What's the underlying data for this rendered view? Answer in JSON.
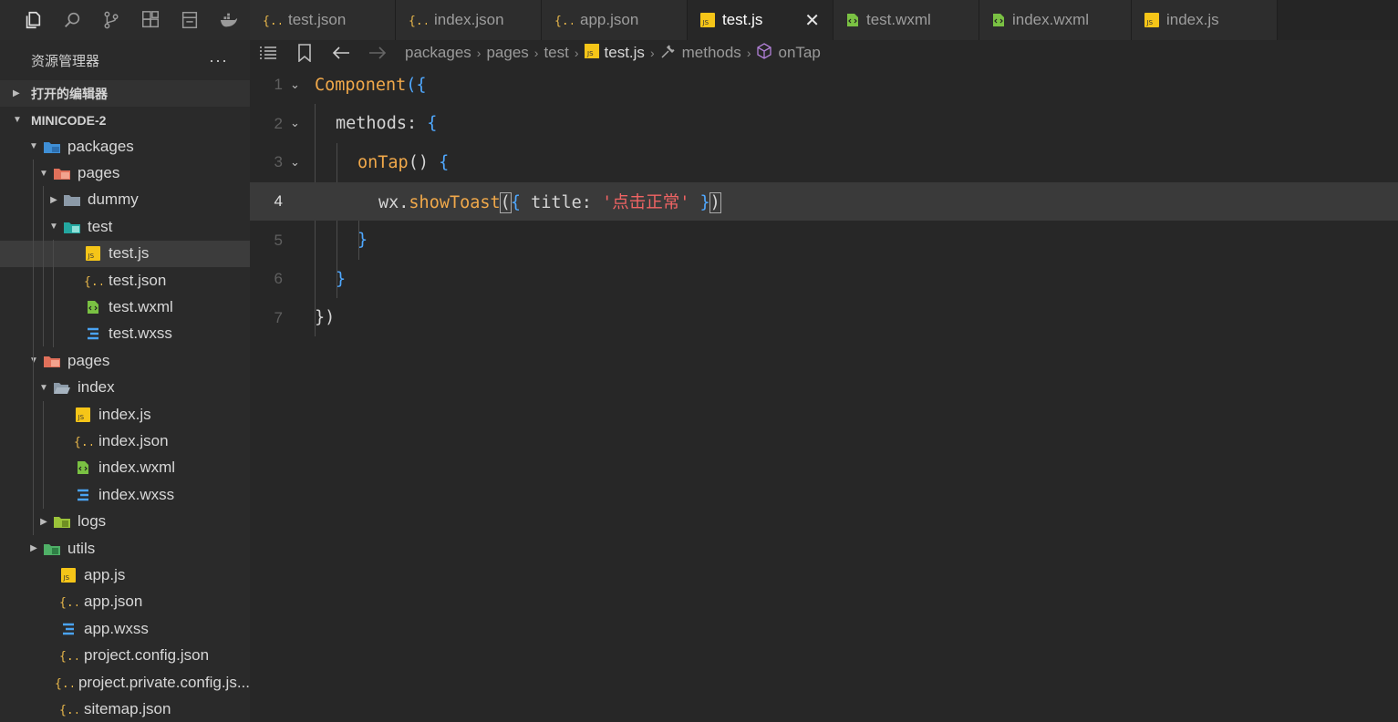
{
  "activity_bar": {
    "icons": [
      "files-icon",
      "search-icon",
      "source-control-icon",
      "extensions-icon",
      "storage-icon",
      "docker-icon"
    ]
  },
  "tabs": [
    {
      "label": "test.json",
      "type": "json",
      "active": false
    },
    {
      "label": "index.json",
      "type": "json",
      "active": false
    },
    {
      "label": "app.json",
      "type": "json",
      "active": false
    },
    {
      "label": "test.js",
      "type": "js",
      "active": true
    },
    {
      "label": "test.wxml",
      "type": "wxml",
      "active": false
    },
    {
      "label": "index.wxml",
      "type": "wxml",
      "active": false
    },
    {
      "label": "index.js",
      "type": "js",
      "active": false
    }
  ],
  "sidebar": {
    "title": "资源管理器",
    "more": "···",
    "open_editors": "打开的编辑器",
    "project": "MINICODE-2",
    "tree": [
      {
        "label": "packages",
        "kind": "folder-blue",
        "caret": "▼"
      },
      {
        "label": "pages",
        "kind": "folder-red",
        "caret": "▼"
      },
      {
        "label": "dummy",
        "kind": "folder-gray",
        "caret": "▶"
      },
      {
        "label": "test",
        "kind": "folder-teal",
        "caret": "▼"
      },
      {
        "label": "test.js",
        "kind": "js",
        "caret": ""
      },
      {
        "label": "test.json",
        "kind": "json",
        "caret": ""
      },
      {
        "label": "test.wxml",
        "kind": "wxml",
        "caret": ""
      },
      {
        "label": "test.wxss",
        "kind": "wxss",
        "caret": ""
      },
      {
        "label": "pages",
        "kind": "folder-red",
        "caret": "▼"
      },
      {
        "label": "index",
        "kind": "folder-gray-open",
        "caret": "▼"
      },
      {
        "label": "index.js",
        "kind": "js",
        "caret": ""
      },
      {
        "label": "index.json",
        "kind": "json",
        "caret": ""
      },
      {
        "label": "index.wxml",
        "kind": "wxml",
        "caret": ""
      },
      {
        "label": "index.wxss",
        "kind": "wxss",
        "caret": ""
      },
      {
        "label": "logs",
        "kind": "folder-green",
        "caret": "▶"
      },
      {
        "label": "utils",
        "kind": "folder-green2",
        "caret": "▶"
      },
      {
        "label": "app.js",
        "kind": "js",
        "caret": ""
      },
      {
        "label": "app.json",
        "kind": "json",
        "caret": ""
      },
      {
        "label": "app.wxss",
        "kind": "wxss",
        "caret": ""
      },
      {
        "label": "project.config.json",
        "kind": "json",
        "caret": ""
      },
      {
        "label": "project.private.config.js...",
        "kind": "json",
        "caret": ""
      },
      {
        "label": "sitemap.json",
        "kind": "json",
        "caret": ""
      }
    ]
  },
  "breadcrumb": {
    "parts": [
      "packages",
      "pages",
      "test",
      "test.js",
      "methods",
      "onTap"
    ]
  },
  "editor": {
    "lines": [
      {
        "num": "1",
        "fold": "⌄"
      },
      {
        "num": "2",
        "fold": "⌄"
      },
      {
        "num": "3",
        "fold": "⌄"
      },
      {
        "num": "4",
        "fold": ""
      },
      {
        "num": "5",
        "fold": ""
      },
      {
        "num": "6",
        "fold": ""
      },
      {
        "num": "7",
        "fold": ""
      }
    ],
    "tokens": {
      "l1_fn": "Component",
      "l1_br": "({",
      "l2_key": "methods: ",
      "l2_br": "{",
      "l3_fn": "onTap",
      "l3_paren": "()",
      "l3_br": " {",
      "l4_obj": "wx.",
      "l4_fn": "showToast",
      "l4_open": "(",
      "l4_brace_open": "{",
      "l4_key": " title: ",
      "l4_str": "'点击正常'",
      "l4_brace_close": " }",
      "l4_close": ")",
      "l5": "}",
      "l6": "}",
      "l7": "})"
    }
  },
  "colors": {
    "accent_js": "#f5c518",
    "json": "#e9b84b",
    "wxml": "#7ac143",
    "wxss": "#4aa3f2"
  }
}
